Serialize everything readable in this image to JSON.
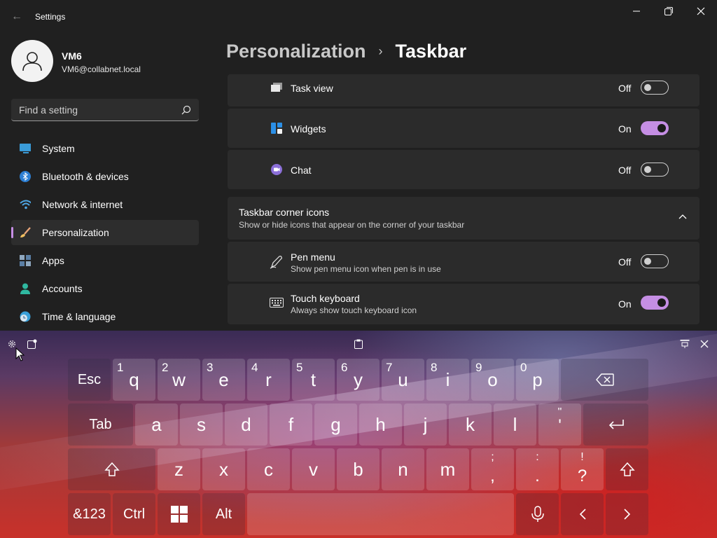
{
  "app": {
    "title": "Settings"
  },
  "user": {
    "name": "VM6",
    "email": "VM6@collabnet.local"
  },
  "search": {
    "placeholder": "Find a setting"
  },
  "nav": {
    "items": [
      {
        "label": "System",
        "icon": "system-icon"
      },
      {
        "label": "Bluetooth & devices",
        "icon": "bluetooth-icon"
      },
      {
        "label": "Network & internet",
        "icon": "wifi-icon"
      },
      {
        "label": "Personalization",
        "icon": "brush-icon",
        "active": true
      },
      {
        "label": "Apps",
        "icon": "apps-icon"
      },
      {
        "label": "Accounts",
        "icon": "person-icon"
      },
      {
        "label": "Time & language",
        "icon": "globe-clock-icon"
      }
    ]
  },
  "breadcrumb": {
    "parent": "Personalization",
    "separator": "›",
    "current": "Taskbar"
  },
  "taskbar_items": [
    {
      "title": "Task view",
      "state": "Off",
      "on": false,
      "icon": "task-view-icon"
    },
    {
      "title": "Widgets",
      "state": "On",
      "on": true,
      "icon": "widgets-icon"
    },
    {
      "title": "Chat",
      "state": "Off",
      "on": false,
      "icon": "chat-icon"
    }
  ],
  "corner_icons": {
    "title": "Taskbar corner icons",
    "subtitle": "Show or hide icons that appear on the corner of your taskbar",
    "items": [
      {
        "title": "Pen menu",
        "subtitle": "Show pen menu icon when pen is in use",
        "state": "Off",
        "on": false,
        "icon": "pen-icon"
      },
      {
        "title": "Touch keyboard",
        "subtitle": "Always show touch keyboard icon",
        "state": "On",
        "on": true,
        "icon": "keyboard-icon"
      }
    ]
  },
  "keyboard": {
    "row1": {
      "esc": "Esc",
      "keys": [
        {
          "num": "1",
          "char": "q"
        },
        {
          "num": "2",
          "char": "w"
        },
        {
          "num": "3",
          "char": "e"
        },
        {
          "num": "4",
          "char": "r"
        },
        {
          "num": "5",
          "char": "t"
        },
        {
          "num": "6",
          "char": "y"
        },
        {
          "num": "7",
          "char": "u"
        },
        {
          "num": "8",
          "char": "i"
        },
        {
          "num": "9",
          "char": "o"
        },
        {
          "num": "0",
          "char": "p"
        }
      ]
    },
    "row2": {
      "tab": "Tab",
      "keys": [
        "a",
        "s",
        "d",
        "f",
        "g",
        "h",
        "j",
        "k",
        "l"
      ],
      "quote_top": "\"",
      "quote_bot": "'"
    },
    "row3": {
      "keys": [
        "z",
        "x",
        "c",
        "v",
        "b",
        "n",
        "m"
      ],
      "semicolon": {
        "top": ";",
        "bot": ","
      },
      "colon": {
        "top": ":",
        "bot": "."
      },
      "excl": {
        "top": "!",
        "bot": "?"
      }
    },
    "row4": {
      "sym": "&123",
      "ctrl": "Ctrl",
      "alt": "Alt"
    },
    "accent": "#c58ee4"
  }
}
